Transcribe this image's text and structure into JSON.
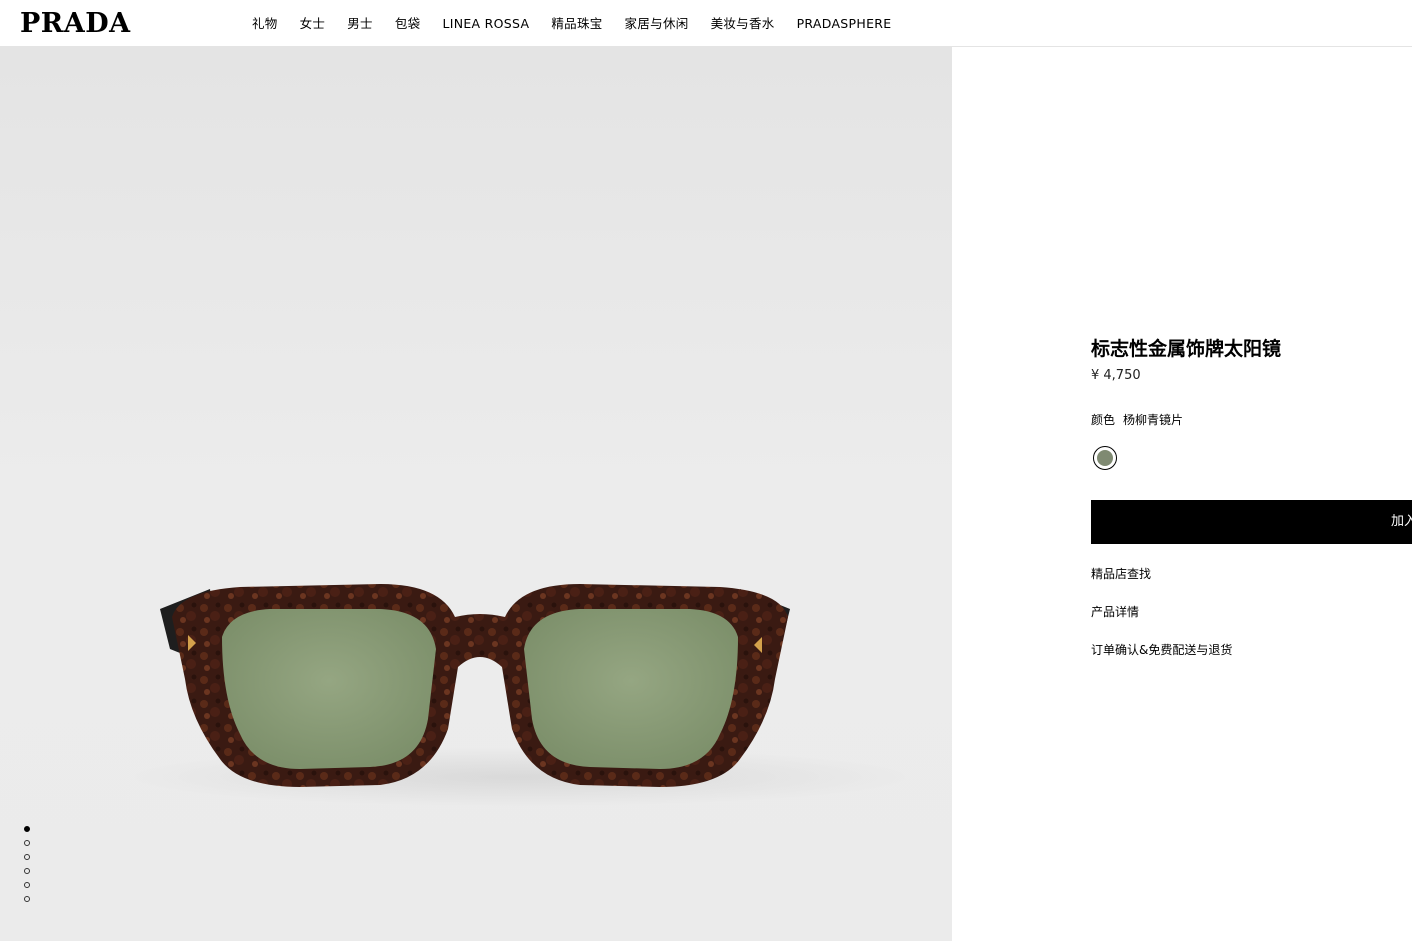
{
  "header": {
    "logo": "PRADA",
    "nav": [
      "礼物",
      "女士",
      "男士",
      "包袋",
      "LINEA ROSSA",
      "精品珠宝",
      "家居与休闲",
      "美妆与香水",
      "PRADASPHERE"
    ]
  },
  "gallery": {
    "image_count": 6,
    "active_index": 0,
    "lens_color": "#8a9b76",
    "frame_color": "#3a1a12"
  },
  "product": {
    "title": "标志性金属饰牌太阳镜",
    "price": "¥ 4,750",
    "color_label": "颜色",
    "color_value": "杨柳青镜片",
    "swatch_color": "#7f8a72",
    "add_button": "加入",
    "links": [
      "精品店查找",
      "产品详情",
      "订单确认&免费配送与退货"
    ]
  }
}
